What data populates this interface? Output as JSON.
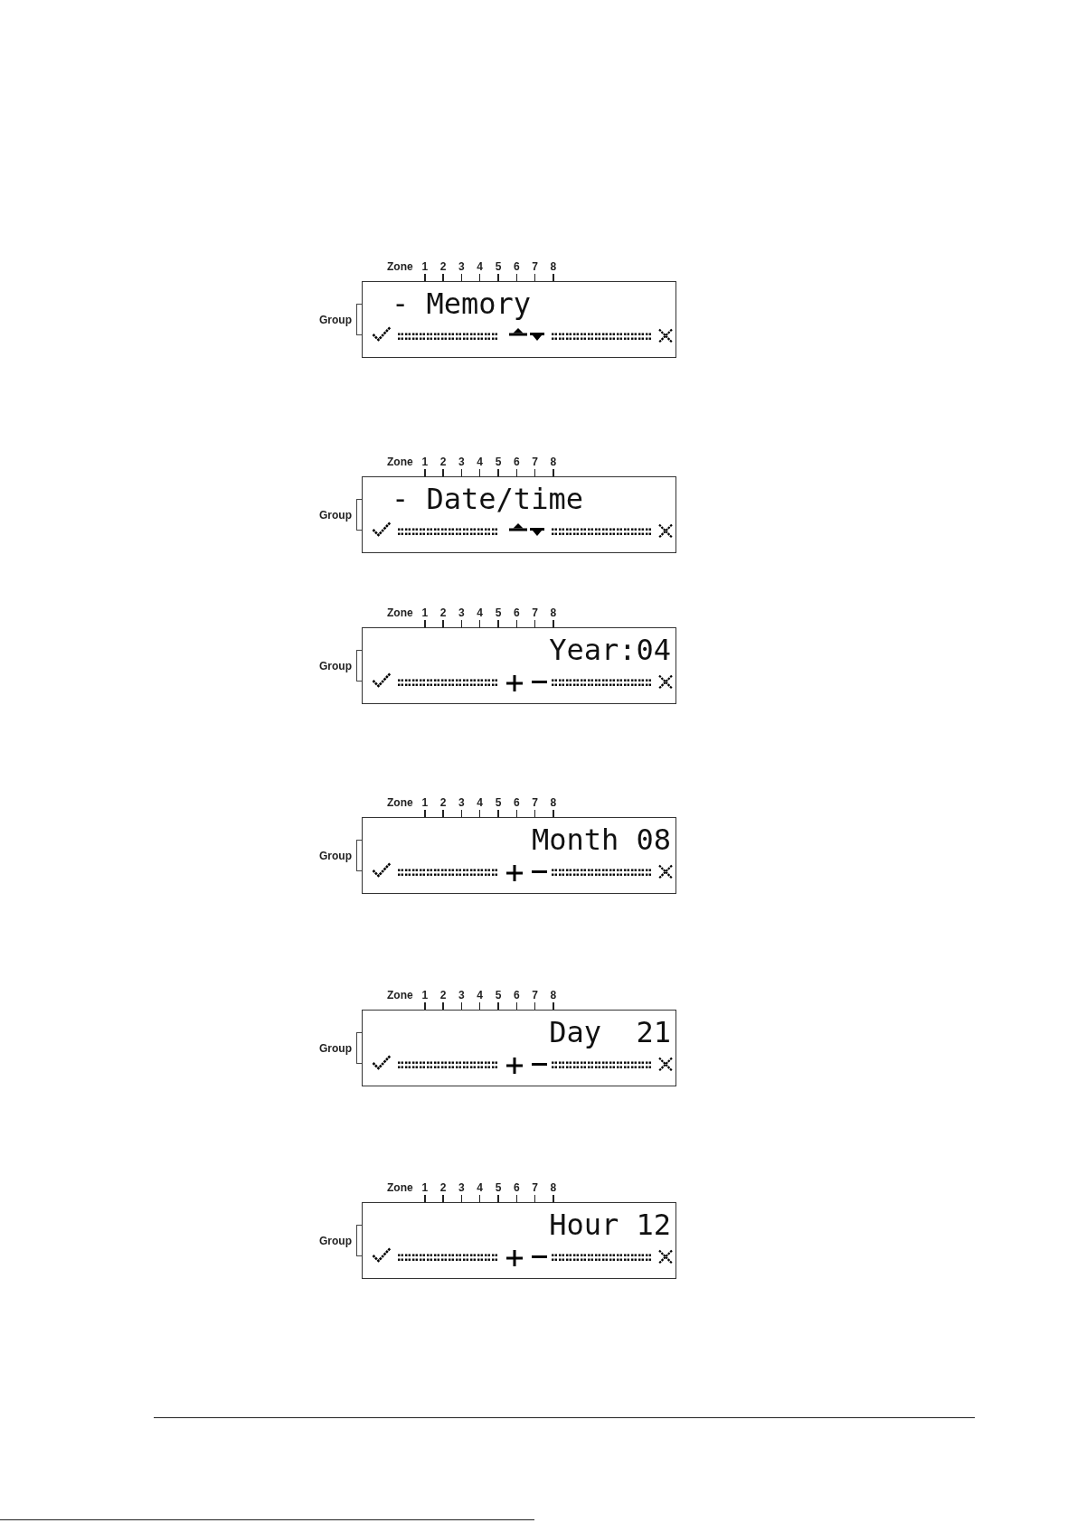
{
  "displays": [
    {
      "kind": "menu",
      "zone_label": "Zone",
      "zones": [
        "1",
        "2",
        "3",
        "4",
        "5",
        "6",
        "7",
        "8"
      ],
      "group_label": "Group",
      "text": "- Memory"
    },
    {
      "kind": "menu",
      "zone_label": "Zone",
      "zones": [
        "1",
        "2",
        "3",
        "4",
        "5",
        "6",
        "7",
        "8"
      ],
      "group_label": "Group",
      "text": "- Date/time"
    },
    {
      "kind": "setting",
      "zone_label": "Zone",
      "zones": [
        "1",
        "2",
        "3",
        "4",
        "5",
        "6",
        "7",
        "8"
      ],
      "group_label": "Group",
      "text": "Year:04"
    },
    {
      "kind": "setting",
      "zone_label": "Zone",
      "zones": [
        "1",
        "2",
        "3",
        "4",
        "5",
        "6",
        "7",
        "8"
      ],
      "group_label": "Group",
      "text": "Month 08"
    },
    {
      "kind": "setting",
      "zone_label": "Zone",
      "zones": [
        "1",
        "2",
        "3",
        "4",
        "5",
        "6",
        "7",
        "8"
      ],
      "group_label": "Group",
      "text": "Day  21"
    },
    {
      "kind": "setting",
      "zone_label": "Zone",
      "zones": [
        "1",
        "2",
        "3",
        "4",
        "5",
        "6",
        "7",
        "8"
      ],
      "group_label": "Group",
      "text": "Hour 12"
    }
  ]
}
